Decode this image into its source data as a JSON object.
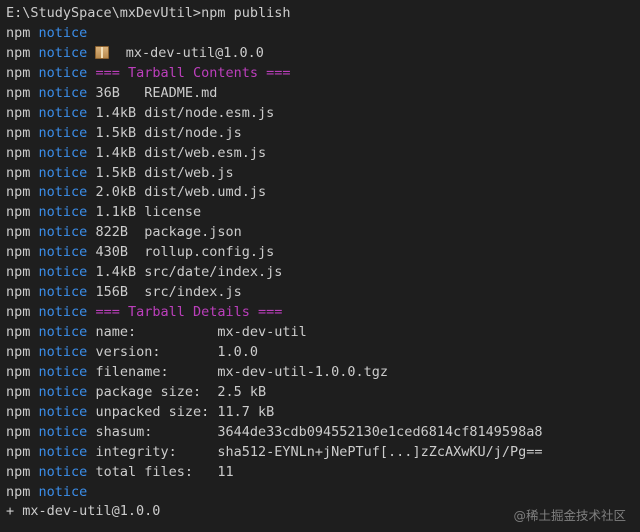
{
  "terminal": {
    "prompt_line": "E:\\StudySpace\\mxDevUtil>npm publish",
    "prefix": "npm",
    "notice_word": "notice",
    "blank_notice": "",
    "package_icon": "package-icon",
    "package_id": "mx-dev-util@1.0.0",
    "contents_header": "=== Tarball Contents ===",
    "files": [
      {
        "size": "36B  ",
        "path": "README.md"
      },
      {
        "size": "1.4kB",
        "path": "dist/node.esm.js"
      },
      {
        "size": "1.5kB",
        "path": "dist/node.js"
      },
      {
        "size": "1.4kB",
        "path": "dist/web.esm.js"
      },
      {
        "size": "1.5kB",
        "path": "dist/web.js"
      },
      {
        "size": "2.0kB",
        "path": "dist/web.umd.js"
      },
      {
        "size": "1.1kB",
        "path": "license"
      },
      {
        "size": "822B ",
        "path": "package.json"
      },
      {
        "size": "430B ",
        "path": "rollup.config.js"
      },
      {
        "size": "1.4kB",
        "path": "src/date/index.js"
      },
      {
        "size": "156B ",
        "path": "src/index.js"
      }
    ],
    "details_header": "=== Tarball Details ===",
    "details": [
      {
        "key": "name:          ",
        "value": "mx-dev-util"
      },
      {
        "key": "version:       ",
        "value": "1.0.0"
      },
      {
        "key": "filename:      ",
        "value": "mx-dev-util-1.0.0.tgz"
      },
      {
        "key": "package size:  ",
        "value": "2.5 kB"
      },
      {
        "key": "unpacked size: ",
        "value": "11.7 kB"
      },
      {
        "key": "shasum:        ",
        "value": "3644de33cdb094552130e1ced6814cf8149598a8"
      },
      {
        "key": "integrity:     ",
        "value": "sha512-EYNLn+jNePTuf[...]zZcAXwKU/j/Pg=="
      },
      {
        "key": "total files:   ",
        "value": "11"
      }
    ],
    "result_line": "+ mx-dev-util@1.0.0"
  },
  "watermark": "@稀土掘金技术社区",
  "colors": {
    "background": "#1e1e1e",
    "text": "#cccccc",
    "notice": "#3b8eea",
    "section_header": "#bc3fbc"
  }
}
